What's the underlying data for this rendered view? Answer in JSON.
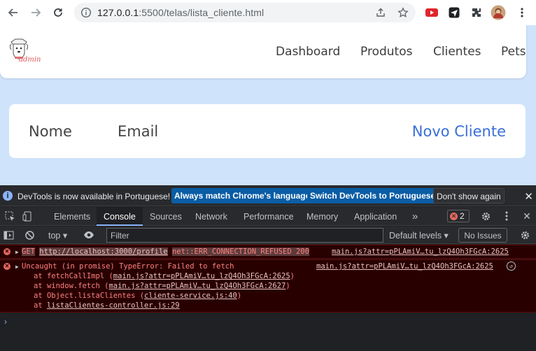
{
  "browser": {
    "url_host": "127.0.0.1",
    "url_path": ":5500/telas/lista_cliente.html"
  },
  "site": {
    "logo_text": "admin",
    "nav": [
      "Dashboard",
      "Produtos",
      "Clientes",
      "Pets"
    ],
    "table_headers": {
      "name": "Nome",
      "email": "Email"
    },
    "new_client_label": "Novo Cliente"
  },
  "devtools": {
    "infobar": {
      "message": "DevTools is now available in Portuguese!",
      "btn_match": "Always match Chrome's language",
      "btn_switch": "Switch DevTools to Portuguese",
      "btn_dismiss": "Don't show again"
    },
    "tabs": [
      "Elements",
      "Console",
      "Sources",
      "Network",
      "Performance",
      "Memory",
      "Application"
    ],
    "error_count": "2",
    "filterbar": {
      "context": "top",
      "filter_placeholder": "Filter",
      "levels": "Default levels",
      "issues": "No Issues"
    },
    "messages": {
      "m1": {
        "method": "GET",
        "url": "http://localhost:3000/profile",
        "error": "net::ERR_CONNECTION_REFUSED 200",
        "source": "main.js?attr=pPLAmiV…tu_lzQ4Oh3FGcA:2625"
      },
      "m2": {
        "title": "Uncaught (in promise) TypeError: Failed to fetch",
        "source": "main.js?attr=pPLAmiV…tu_lzQ4Oh3FGcA:2625",
        "s1_prefix": "at fetchCallImpl (",
        "s1_link": "main.js?attr=pPLAmiV…tu_lzQ4Oh3FGcA:2625",
        "s1_suffix": ")",
        "s2_prefix": "at window.fetch (",
        "s2_link": "main.js?attr=pPLAmiV…tu_lzQ4Oh3FGcA:2627",
        "s2_suffix": ")",
        "s3_prefix": "at Object.listaClientes (",
        "s3_link": "cliente-service.js:40",
        "s3_suffix": ")",
        "s4_prefix": "at ",
        "s4_link": "listaClientes-controller.js:29"
      }
    }
  },
  "colors": {
    "page_bg": "#cfe3fb",
    "accent_link": "#3a6fd8",
    "devtools_bg": "#202124",
    "error_bg": "#290000",
    "error_text": "#ff8080",
    "info_button": "#0a5da5"
  }
}
